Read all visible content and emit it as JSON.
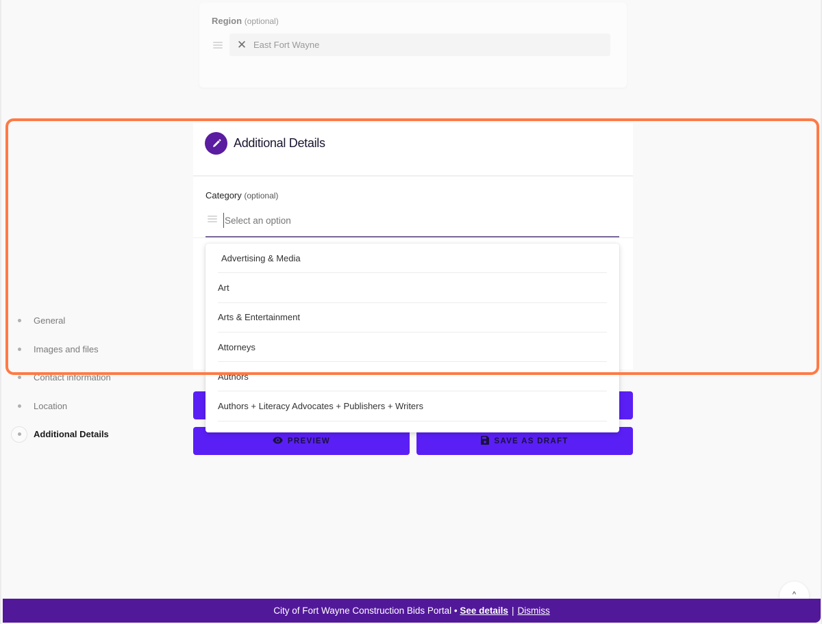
{
  "region": {
    "label": "Region",
    "optional": "(optional)",
    "selected_value": "East Fort Wayne",
    "remove_icon": "close-icon",
    "handle_icon": "drag-handle-icon"
  },
  "section": {
    "icon": "pencil-icon",
    "title": "Additional Details"
  },
  "category": {
    "label": "Category",
    "optional": "(optional)",
    "placeholder": "Select an option",
    "value": "",
    "handle_icon": "drag-handle-icon",
    "options": [
      "Advertising & Media",
      "Art",
      "Arts & Entertainment",
      "Attorneys",
      "Authors",
      "Authors + Literacy Advocates + Publishers + Writers",
      ""
    ]
  },
  "actions": {
    "preview_label": "PREVIEW",
    "preview_icon": "eye-icon",
    "save_draft_label": "SAVE AS DRAFT",
    "save_draft_icon": "floppy-disk-icon"
  },
  "nav": {
    "items": [
      {
        "label": "General",
        "active": false
      },
      {
        "label": "Images and files",
        "active": false
      },
      {
        "label": "Contact information",
        "active": false
      },
      {
        "label": "Location",
        "active": false
      },
      {
        "label": "Additional Details",
        "active": true
      }
    ]
  },
  "banner": {
    "text": "City of Fort Wayne Construction Bids Portal •",
    "see_details": "See details",
    "separator": "|",
    "dismiss": "Dismiss"
  },
  "scroll_top": {
    "icon": "chevron-up-icon",
    "glyph": "^"
  },
  "colors": {
    "accent": "#5a1ff5",
    "brand_purple": "#52189a",
    "highlight": "#ff7a45"
  }
}
